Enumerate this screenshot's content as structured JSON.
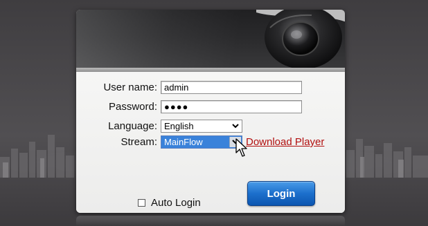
{
  "form": {
    "username_label": "User name:",
    "username_value": "admin",
    "password_label": "Password:",
    "password_value": "●●●●",
    "language_label": "Language:",
    "language_value": "English",
    "stream_label": "Stream:",
    "stream_value": "MainFlow",
    "download_player": "Download Player",
    "auto_login_label": "Auto Login",
    "login_button": "Login"
  },
  "colors": {
    "login_button": "#1c6fcc",
    "download_link": "#b10f0f",
    "stream_selected": "#3a82da"
  },
  "icons": [
    "camera-dome-icon",
    "dropdown-arrow-icon",
    "mouse-cursor-icon"
  ]
}
